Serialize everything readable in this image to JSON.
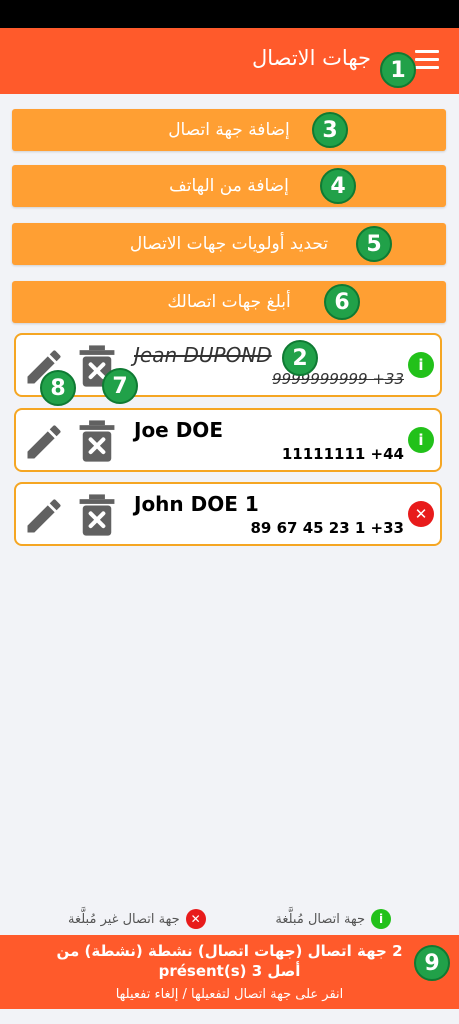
{
  "header": {
    "title": "جهات الاتصال"
  },
  "buttons": {
    "add_contact": "إضافة جهة اتصال",
    "add_from_phone": "إضافة من الهاتف",
    "set_priorities": "تحديد أولويات جهات الاتصال",
    "notify_contacts": "أبلغ جهات اتصالك"
  },
  "contacts": [
    {
      "name": "Jean DUPOND",
      "phone": "9999999999 +33",
      "status": "notified",
      "active": false
    },
    {
      "name": "Joe DOE",
      "phone": "11111111 +44",
      "status": "notified",
      "active": true
    },
    {
      "name": "John DOE 1",
      "phone": "89 67 45 23 1 +33",
      "status": "not-notified",
      "active": true
    }
  ],
  "legend": {
    "notified": "جهة اتصال مُبلَّغة",
    "not_notified": "جهة اتصال غير مُبلَّغة"
  },
  "footer": {
    "summary": "2 جهة اتصال (جهات اتصال) نشطة (نشطة) من أصل 3 présent(s)",
    "hint": "انقر على جهة اتصال لتفعيلها / إلغاء تفعيلها"
  },
  "badges": [
    "1",
    "2",
    "3",
    "4",
    "5",
    "6",
    "7",
    "8",
    "9"
  ],
  "colors": {
    "appbar": "#ff5a2b",
    "button": "#ff9f33",
    "card_border": "#f5a623",
    "badge": "#21a149",
    "ok": "#22c11a",
    "error": "#e81b1b"
  }
}
